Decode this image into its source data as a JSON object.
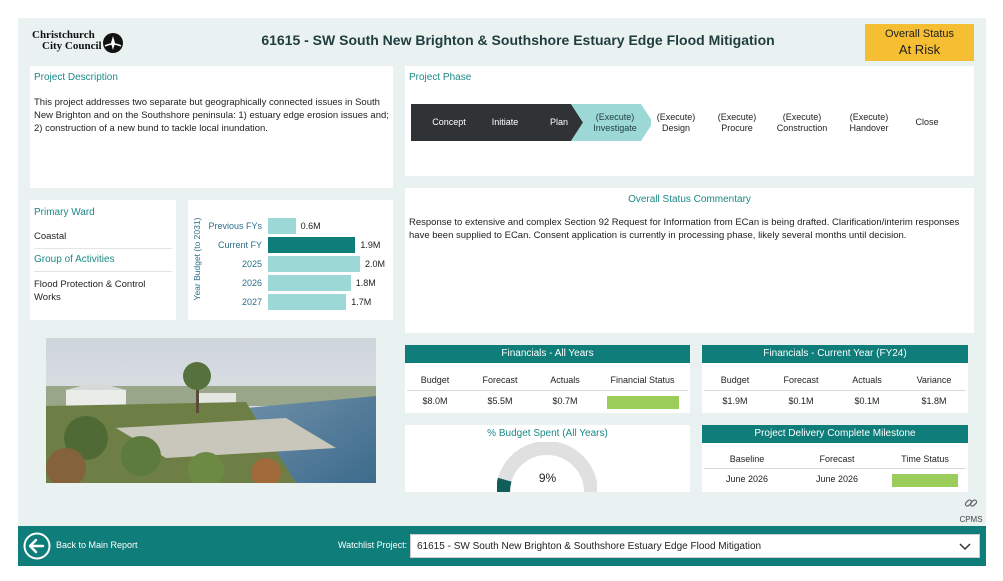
{
  "header": {
    "logo_line1": "Christchurch",
    "logo_line2": "City Council",
    "title": "61615 - SW South New Brighton & Southshore Estuary Edge Flood Mitigation",
    "status_label": "Overall Status",
    "status_value": "At Risk",
    "status_color": "#f6be33"
  },
  "description": {
    "title": "Project Description",
    "text": "This project addresses two separate but geographically connected issues in South New Brighton and on the Southshore peninsula: 1) estuary edge erosion issues and; 2) construction of a new bund to tackle local inundation."
  },
  "phase": {
    "title": "Project Phase",
    "steps": [
      {
        "label": "Concept",
        "state": "done"
      },
      {
        "label": "Initiate",
        "state": "done"
      },
      {
        "label": "Plan",
        "state": "done"
      },
      {
        "label": "(Execute)\nInvestigate",
        "state": "current"
      },
      {
        "label": "(Execute)\nDesign",
        "state": "future"
      },
      {
        "label": "(Execute)\nProcure",
        "state": "future"
      },
      {
        "label": "(Execute)\nConstruction",
        "state": "future"
      },
      {
        "label": "(Execute)\nHandover",
        "state": "future"
      },
      {
        "label": "Close",
        "state": "future"
      }
    ]
  },
  "ward": {
    "ward_title": "Primary Ward",
    "ward_value": "Coastal",
    "activity_title": "Group of Activities",
    "activity_value": "Flood Protection & Control Works"
  },
  "chart_data": {
    "type": "bar",
    "orientation": "horizontal",
    "ylabel": "Year Budget (to 2031)",
    "categories": [
      "Previous FYs",
      "Current FY",
      "2025",
      "2026",
      "2027"
    ],
    "values": [
      0.6,
      1.9,
      2.0,
      1.8,
      1.7
    ],
    "value_labels": [
      "0.6M",
      "1.9M",
      "2.0M",
      "1.8M",
      "1.7M"
    ],
    "highlight_index": 1,
    "colors": {
      "normal": "#9cd9d6",
      "highlight": "#0f7d79"
    }
  },
  "commentary": {
    "title": "Overall Status Commentary",
    "text": "Response to extensive and complex Section 92 Request for Information from ECan is being drafted. Clarification/interim responses have been supplied to ECan. Consent application is currently in processing phase, likely several months until decision."
  },
  "fin_all": {
    "title": "Financials - All Years",
    "headers": [
      "Budget",
      "Forecast",
      "Actuals",
      "Financial Status"
    ],
    "values": [
      "$8.0M",
      "$5.5M",
      "$0.7M",
      ""
    ],
    "status_color": "#9acd5a"
  },
  "fin_current": {
    "title": "Financials - Current Year (FY24)",
    "headers": [
      "Budget",
      "Forecast",
      "Actuals",
      "Variance"
    ],
    "values": [
      "$1.9M",
      "$0.1M",
      "$0.1M",
      "$1.8M"
    ]
  },
  "budget_spent": {
    "title": "% Budget Spent (All Years)",
    "value": "9%",
    "fraction": 0.09
  },
  "milestone": {
    "title": "Project Delivery Complete Milestone",
    "headers": [
      "Baseline",
      "Forecast",
      "Time Status"
    ],
    "values": [
      "June 2026",
      "June 2026",
      ""
    ],
    "status_color": "#9acd5a"
  },
  "cpms": {
    "label": "CPMS",
    "icon": "link-icon"
  },
  "footer": {
    "back_label": "Back to Main Report",
    "watchlist_label": "Watchlist Project:",
    "watchlist_value": "61615 - SW South New Brighton & Southshore Estuary Edge Flood Mitigation"
  }
}
